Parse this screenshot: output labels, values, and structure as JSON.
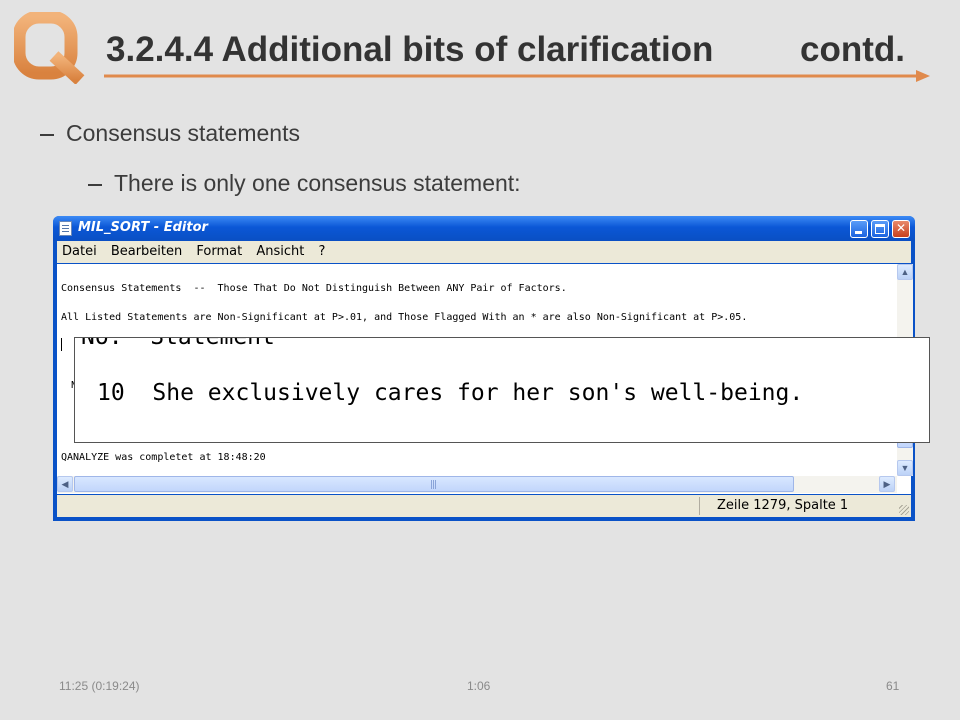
{
  "slide": {
    "title": "3.2.4.4 Additional bits of clarification",
    "title_suffix": "contd.",
    "accent_color": "#e08a4c",
    "logo_letter": "Q",
    "bullets": [
      "Consensus statements",
      "There is only one consensus statement:"
    ]
  },
  "window": {
    "title": "MIL_SORT - Editor",
    "controls": [
      "minimize",
      "maximize",
      "close"
    ],
    "menu": [
      {
        "label": "Datei"
      },
      {
        "label": "Bearbeiten"
      },
      {
        "label": "Format"
      },
      {
        "label": "Ansicht"
      },
      {
        "label": "?"
      }
    ],
    "lines": [
      "Consensus Statements  --  Those That Do Not Distinguish Between ANY Pair of Factors.",
      "All Listed Statements are Non-Significant at P>.01, and Those Flagged With an * are also Non-Significant at P>.05.",
      "N",
      "QANALYZE was completet at 18:48:20"
    ],
    "status": "Zeile 1279, Spalte 1"
  },
  "zoom": {
    "header": "No.  Statement",
    "row": "10  She exclusively cares for her son's well-being."
  },
  "footer": {
    "left": "11:25  (0:19:24)",
    "middle": "1:06",
    "right": "61"
  }
}
